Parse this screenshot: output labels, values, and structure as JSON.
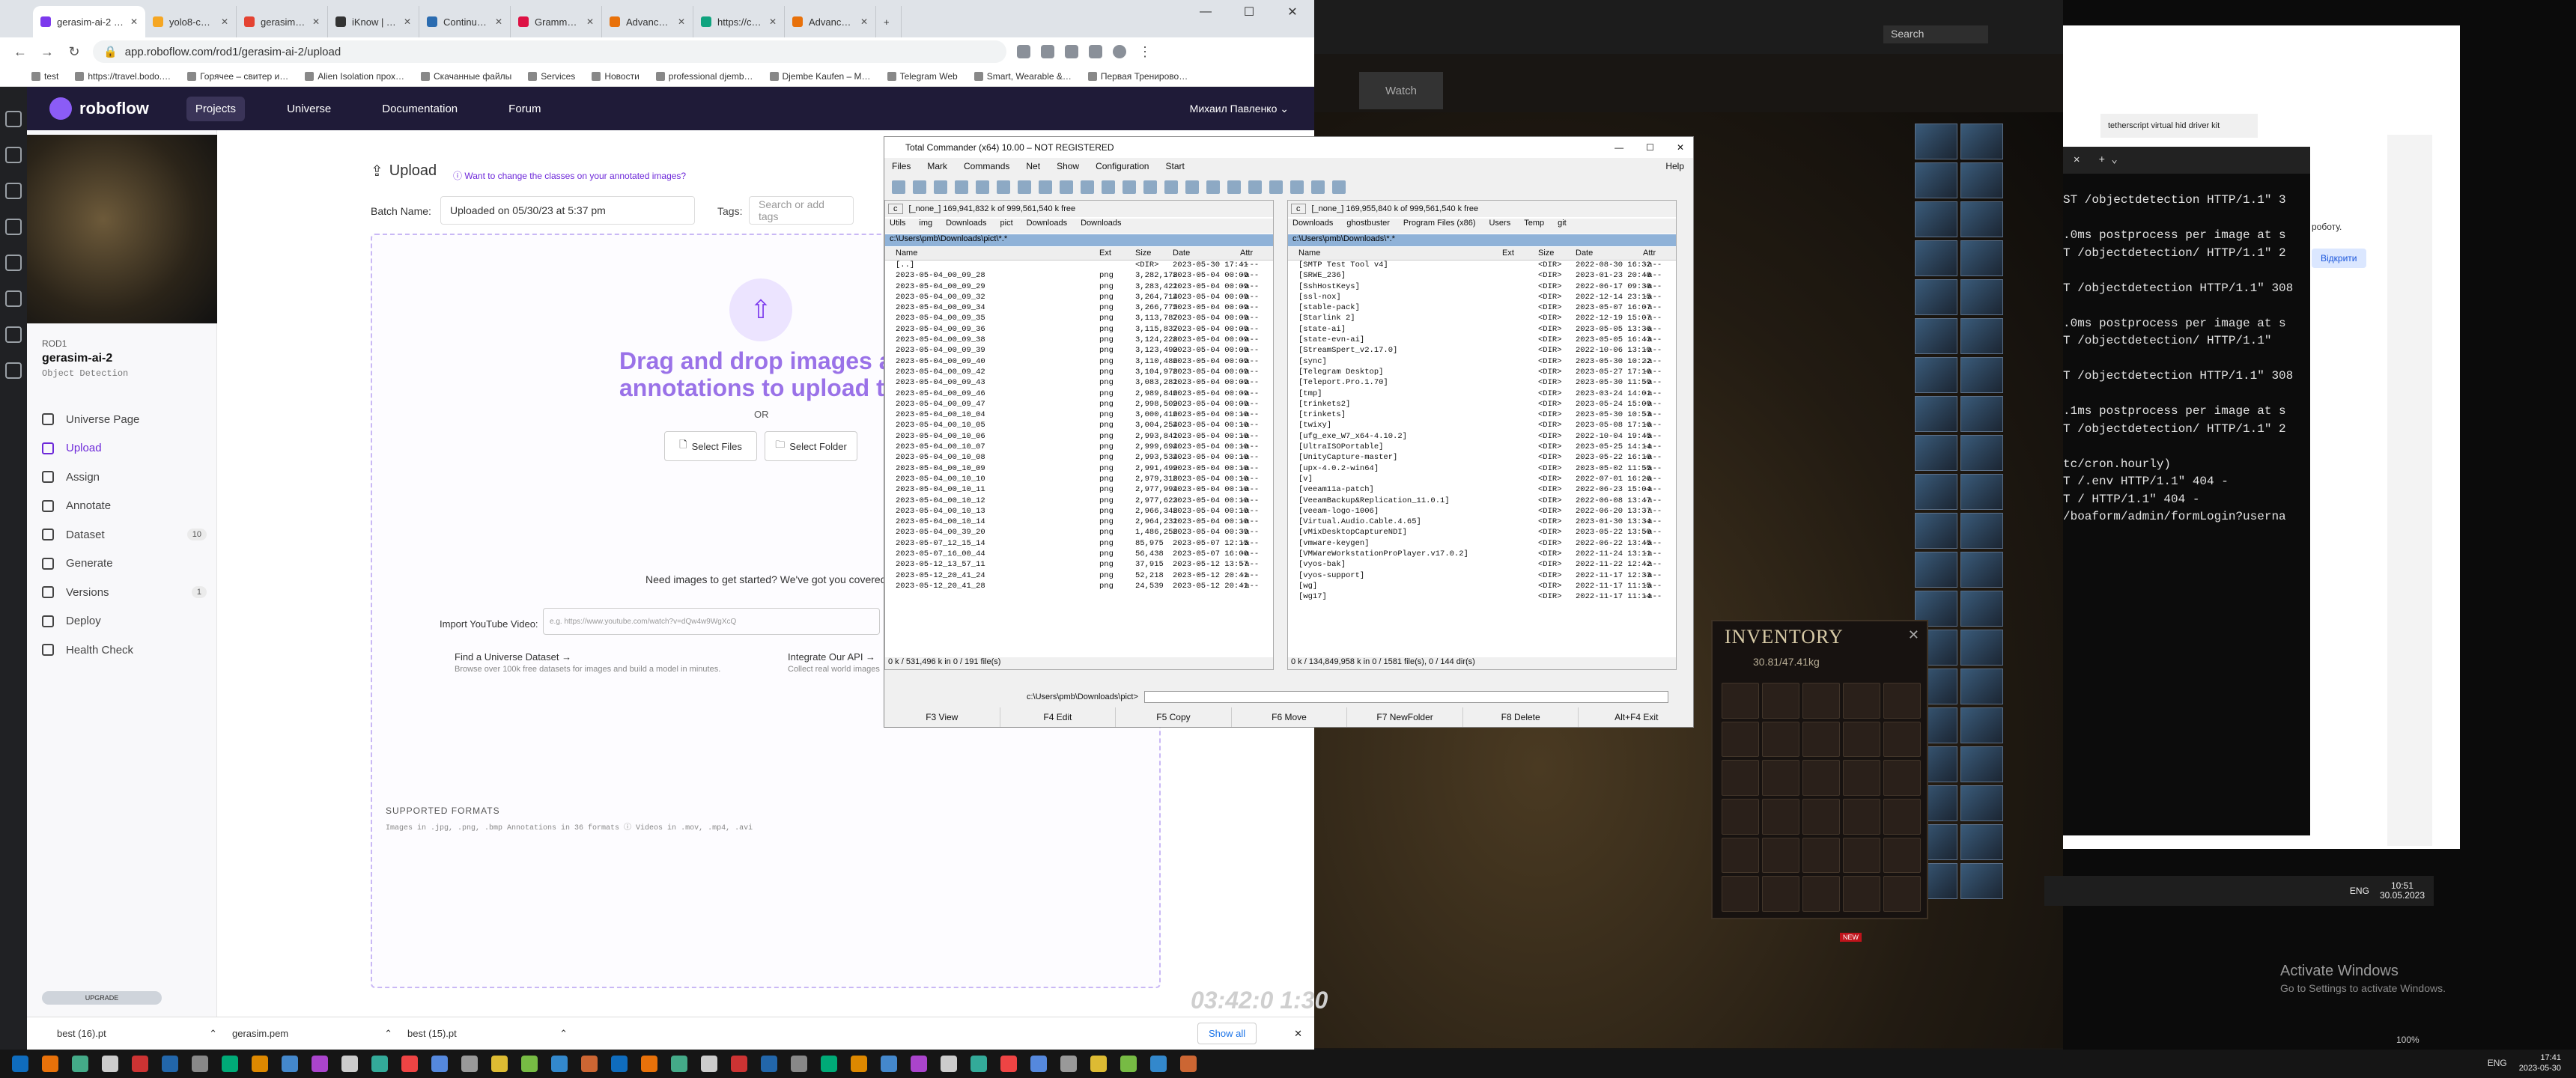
{
  "browser": {
    "tabs": [
      {
        "label": "gerasim-ai-2 Data",
        "color": "#7c3aed",
        "active": true
      },
      {
        "label": "yolo8-custom-train",
        "color": "#f5a623"
      },
      {
        "label": "gerasim: Todoist",
        "color": "#e44332"
      },
      {
        "label": "iKnow | You study",
        "color": "#333333"
      },
      {
        "label": "Continuous asynchr",
        "color": "#2b6cb0"
      },
      {
        "label": "Grammar: the com",
        "color": "#d14"
      },
      {
        "label": "Advanced C1.1: Su",
        "color": "#e8710a"
      },
      {
        "label": "https://chat.opena",
        "color": "#10a37f"
      },
      {
        "label": "Advanced C1.1: Su",
        "color": "#e8710a"
      }
    ],
    "url": "app.roboflow.com/rod1/gerasim-ai-2/upload",
    "bookmarks": [
      "test",
      "https://travel.bodo.…",
      "Горячее – свитер и…",
      "Alien Isolation прох…",
      "Скачанные файлы",
      "Services",
      "Новости",
      "professional djemb…",
      "Djembe Kaufen – M…",
      "Telegram Web",
      "Smart, Wearable &…",
      "Первая Тренирово…"
    ]
  },
  "roboflow": {
    "brand": "roboflow",
    "nav": [
      "Projects",
      "Universe",
      "Documentation",
      "Forum"
    ],
    "user": "Михаил Павленко",
    "project_owner": "ROD1",
    "project_name": "gerasim-ai-2",
    "project_type": "Object Detection",
    "sidebar": [
      {
        "label": "Universe Page",
        "count": ""
      },
      {
        "label": "Upload",
        "count": ""
      },
      {
        "label": "Assign",
        "count": ""
      },
      {
        "label": "Annotate",
        "count": ""
      },
      {
        "label": "Dataset",
        "count": "10"
      },
      {
        "label": "Generate",
        "count": ""
      },
      {
        "label": "Versions",
        "count": "1"
      },
      {
        "label": "Deploy",
        "count": ""
      },
      {
        "label": "Health Check",
        "count": ""
      }
    ],
    "upgrade": "UPGRADE",
    "upload": {
      "title": "Upload",
      "hint": "Want to change the classes on your annotated images?",
      "batch_label": "Batch Name:",
      "batch_value": "Uploaded on 05/30/23 at 5:37 pm",
      "tags_label": "Tags:",
      "tags_placeholder": "Search or add tags",
      "drop_title_1": "Drag and drop images and",
      "drop_title_2": "annotations to upload them",
      "or": "OR",
      "select_files": "Select Files",
      "select_folder": "Select Folder",
      "need_images": "Need images to get started? We've got you covered.",
      "youtube_label": "Import YouTube Video:",
      "youtube_placeholder": "e.g. https://www.youtube.com/watch?v=dQw4w9WgXcQ",
      "universe_title": "Find a Universe Dataset →",
      "universe_desc": "Browse over 100k free datasets for images and build a model in minutes.",
      "api_title": "Integrate Our API →",
      "api_desc": "Collect real world images",
      "formats_title": "SUPPORTED FORMATS",
      "formats_line": "Images in .jpg, .png, .bmp     Annotations in 36 formats ⓘ     Videos in .mov, .mp4, .avi"
    }
  },
  "downloads": {
    "items": [
      "best (16).pt",
      "gerasim.pem",
      "best (15).pt"
    ],
    "show_all": "Show all"
  },
  "tc": {
    "title": "Total Commander (x64) 10.00 – NOT REGISTERED",
    "menu": [
      "Files",
      "Mark",
      "Commands",
      "Net",
      "Show",
      "Configuration",
      "Start"
    ],
    "help": "Help",
    "left": {
      "drive": "c",
      "drive_info": "[_none_] 169,941,832 k of 999,561,540 k free",
      "tabs": [
        "Utils",
        "img",
        "Downloads",
        "pict",
        "Downloads",
        "Downloads"
      ],
      "path": "c:\\Users\\pmb\\Downloads\\pict\\*.*",
      "headers": [
        "Name",
        "Ext",
        "Size",
        "Date",
        "Attr"
      ],
      "rows": [
        [
          "[..]",
          "",
          "<DIR>",
          "2023-05-30 17:41",
          "----"
        ],
        [
          "2023-05-04_00_09_28",
          "png",
          "3,282,178",
          "2023-05-04 00:09",
          "-a--"
        ],
        [
          "2023-05-04_00_09_29",
          "png",
          "3,283,421",
          "2023-05-04 00:09",
          "-a--"
        ],
        [
          "2023-05-04_00_09_32",
          "png",
          "3,264,714",
          "2023-05-04 00:09",
          "-a--"
        ],
        [
          "2023-05-04_00_09_34",
          "png",
          "3,266,775",
          "2023-05-04 00:09",
          "-a--"
        ],
        [
          "2023-05-04_00_09_35",
          "png",
          "3,113,787",
          "2023-05-04 00:09",
          "-a--"
        ],
        [
          "2023-05-04_00_09_36",
          "png",
          "3,115,837",
          "2023-05-04 00:09",
          "-a--"
        ],
        [
          "2023-05-04_00_09_38",
          "png",
          "3,124,228",
          "2023-05-04 00:09",
          "-a--"
        ],
        [
          "2023-05-04_00_09_39",
          "png",
          "3,123,490",
          "2023-05-04 00:09",
          "-a--"
        ],
        [
          "2023-05-04_00_09_40",
          "png",
          "3,110,486",
          "2023-05-04 00:09",
          "-a--"
        ],
        [
          "2023-05-04_00_09_42",
          "png",
          "3,104,978",
          "2023-05-04 00:09",
          "-a--"
        ],
        [
          "2023-05-04_00_09_43",
          "png",
          "3,083,281",
          "2023-05-04 00:09",
          "-a--"
        ],
        [
          "2023-05-04_00_09_46",
          "png",
          "2,989,846",
          "2023-05-04 00:09",
          "-a--"
        ],
        [
          "2023-05-04_00_09_47",
          "png",
          "2,998,509",
          "2023-05-04 00:09",
          "-a--"
        ],
        [
          "2023-05-04_00_10_04",
          "png",
          "3,000,416",
          "2023-05-04 00:10",
          "-a--"
        ],
        [
          "2023-05-04_00_10_05",
          "png",
          "3,004,254",
          "2023-05-04 00:10",
          "-a--"
        ],
        [
          "2023-05-04_00_10_06",
          "png",
          "2,993,841",
          "2023-05-04 00:10",
          "-a--"
        ],
        [
          "2023-05-04_00_10_07",
          "png",
          "2,999,694",
          "2023-05-04 00:10",
          "-a--"
        ],
        [
          "2023-05-04_00_10_08",
          "png",
          "2,993,534",
          "2023-05-04 00:10",
          "-a--"
        ],
        [
          "2023-05-04_00_10_09",
          "png",
          "2,991,499",
          "2023-05-04 00:10",
          "-a--"
        ],
        [
          "2023-05-04_00_10_10",
          "png",
          "2,979,318",
          "2023-05-04 00:10",
          "-a--"
        ],
        [
          "2023-05-04_00_10_11",
          "png",
          "2,977,994",
          "2023-05-04 00:10",
          "-a--"
        ],
        [
          "2023-05-04_00_10_12",
          "png",
          "2,977,623",
          "2023-05-04 00:10",
          "-a--"
        ],
        [
          "2023-05-04_00_10_13",
          "png",
          "2,966,348",
          "2023-05-04 00:10",
          "-a--"
        ],
        [
          "2023-05-04_00_10_14",
          "png",
          "2,964,231",
          "2023-05-04 00:10",
          "-a--"
        ],
        [
          "2023-05-04_00_39_20",
          "png",
          "1,486,258",
          "2023-05-04 00:39",
          "-a--"
        ],
        [
          "2023-05-07_12_15_14",
          "png",
          "85,975",
          "2023-05-07 12:15",
          "-a--"
        ],
        [
          "2023-05-07_16_00_44",
          "png",
          "56,438",
          "2023-05-07 16:00",
          "-a--"
        ],
        [
          "2023-05-12_13_57_11",
          "png",
          "37,915",
          "2023-05-12 13:57",
          "-a--"
        ],
        [
          "2023-05-12_20_41_24",
          "png",
          "52,218",
          "2023-05-12 20:41",
          "-a--"
        ],
        [
          "2023-05-12_20_41_28",
          "png",
          "24,539",
          "2023-05-12 20:41",
          "-a--"
        ]
      ],
      "status": "0 k / 531,496 k in 0 / 191 file(s)"
    },
    "right": {
      "drive": "c",
      "drive_info": "[_none_] 169,955,840 k of 999,561,540 k free",
      "tabs": [
        "Downloads",
        "ghostbuster",
        "Program Files (x86)",
        "Users",
        "Temp",
        "git"
      ],
      "path": "c:\\Users\\pmb\\Downloads\\*.*",
      "headers": [
        "Name",
        "Ext",
        "Size",
        "Date",
        "Attr"
      ],
      "rows": [
        [
          "[SMTP Test Tool v4]",
          "",
          "<DIR>",
          "2022-08-30 16:32",
          "-a--"
        ],
        [
          "[SRWE_236]",
          "",
          "<DIR>",
          "2023-01-23 20:48",
          "-a--"
        ],
        [
          "[SshHostKeys]",
          "",
          "<DIR>",
          "2022-06-17 09:38",
          "-a--"
        ],
        [
          "[ssl-nox]",
          "",
          "<DIR>",
          "2022-12-14 23:15",
          "-a--"
        ],
        [
          "[stable-pack]",
          "",
          "<DIR>",
          "2023-05-07 16:07",
          "-a--"
        ],
        [
          "[Starlink 2]",
          "",
          "<DIR>",
          "2022-12-19 15:07",
          "-a--"
        ],
        [
          "[state-ai]",
          "",
          "<DIR>",
          "2023-05-05 13:36",
          "-a--"
        ],
        [
          "[state-evn-ai]",
          "",
          "<DIR>",
          "2023-05-05 16:43",
          "-a--"
        ],
        [
          "[StreamSpert_v2.17.0]",
          "",
          "<DIR>",
          "2022-10-06 13:19",
          "-a--"
        ],
        [
          "[sync]",
          "",
          "<DIR>",
          "2023-05-30 10:22",
          "-a--"
        ],
        [
          "[Telegram Desktop]",
          "",
          "<DIR>",
          "2023-05-27 17:16",
          "-a--"
        ],
        [
          "[Teleport.Pro.1.70]",
          "",
          "<DIR>",
          "2023-05-30 11:59",
          "-a--"
        ],
        [
          "[tmp]",
          "",
          "<DIR>",
          "2023-03-24 14:01",
          "-a--"
        ],
        [
          "[trinkets2]",
          "",
          "<DIR>",
          "2023-05-24 15:09",
          "-a--"
        ],
        [
          "[trinkets]",
          "",
          "<DIR>",
          "2023-05-30 10:53",
          "-a--"
        ],
        [
          "[twixy]",
          "",
          "<DIR>",
          "2023-05-08 17:16",
          "-a--"
        ],
        [
          "[ufg_exe_W7_x64-4.10.2]",
          "",
          "<DIR>",
          "2022-10-04 19:45",
          "-a--"
        ],
        [
          "[UltraISOPortable]",
          "",
          "<DIR>",
          "2023-05-25 14:14",
          "-a--"
        ],
        [
          "[UnityCapture-master]",
          "",
          "<DIR>",
          "2023-05-22 16:10",
          "-a--"
        ],
        [
          "[upx-4.0.2-win64]",
          "",
          "<DIR>",
          "2023-05-02 11:55",
          "-a--"
        ],
        [
          "[v]",
          "",
          "<DIR>",
          "2022-07-01 16:26",
          "-a--"
        ],
        [
          "[veeam11a-patch]",
          "",
          "<DIR>",
          "2022-06-23 15:04",
          "-a--"
        ],
        [
          "[VeeamBackup&Replication_11.0.1]",
          "",
          "<DIR>",
          "2022-06-08 13:47",
          "-a--"
        ],
        [
          "[veeam-logo-1006]",
          "",
          "<DIR>",
          "2022-06-20 13:37",
          "-a--"
        ],
        [
          "[Virtual.Audio.Cable.4.65]",
          "",
          "<DIR>",
          "2023-01-30 13:34",
          "-a--"
        ],
        [
          "[vMixDesktopCaptureNDI]",
          "",
          "<DIR>",
          "2023-05-22 13:50",
          "-a--"
        ],
        [
          "[vmware-keygen]",
          "",
          "<DIR>",
          "2022-06-22 13:45",
          "-a--"
        ],
        [
          "[VMWareWorkstationProPlayer.v17.0.2]",
          "",
          "<DIR>",
          "2022-11-24 13:11",
          "-a--"
        ],
        [
          "[vyos-bak]",
          "",
          "<DIR>",
          "2022-11-22 12:42",
          "-a--"
        ],
        [
          "[vyos-support]",
          "",
          "<DIR>",
          "2022-11-17 12:33",
          "-a--"
        ],
        [
          "[wg]",
          "",
          "<DIR>",
          "2022-11-17 11:15",
          "-a--"
        ],
        [
          "[wg17]",
          "",
          "<DIR>",
          "2022-11-17 11:14",
          "-a--"
        ]
      ],
      "status": "0 k / 134,849,958 k in 0 / 1581 file(s), 0 / 144 dir(s)"
    },
    "cmd_path": "c:\\Users\\pmb\\Downloads\\pict>",
    "fkeys": [
      "F3 View",
      "F4 Edit",
      "F5 Copy",
      "F6 Move",
      "F7 NewFolder",
      "F8 Delete",
      "Alt+F4 Exit"
    ]
  },
  "game": {
    "search_placeholder": "Search",
    "watch": "Watch",
    "inventory_title": "INVENTORY",
    "inventory_weight": "30.81/47.41kg",
    "timer": "03:42:0 1:30",
    "badge": "NEW"
  },
  "terminal": {
    "lines": [
      "ST /objectdetection HTTP/1.1\" 3",
      "",
      ".0ms postprocess per image at s",
      "T /objectdetection/ HTTP/1.1\" 2",
      "",
      "T /objectdetection HTTP/1.1\" 308",
      "",
      ".0ms postprocess per image at s",
      "T /objectdetection/ HTTP/1.1\"",
      "",
      "T /objectdetection HTTP/1.1\" 308",
      "",
      ".1ms postprocess per image at s",
      "T /objectdetection/ HTTP/1.1\" 2",
      "",
      "tc/cron.hourly)",
      "T /.env HTTP/1.1\" 404 -",
      "T / HTTP/1.1\" 404 -",
      "/boaform/admin/formLogin?userna"
    ]
  },
  "chrome2": {
    "tab": "tetherscript virtual hid driver kit",
    "button": "Відкрити",
    "text": "роботу."
  },
  "windows": {
    "activate_title": "Activate Windows",
    "activate_desc": "Go to Settings to activate Windows.",
    "zoom": "100%",
    "lang": "ENG",
    "time": "17:41",
    "date": "2023-05-30",
    "time2": "10:51",
    "date2": "30.05.2023"
  }
}
